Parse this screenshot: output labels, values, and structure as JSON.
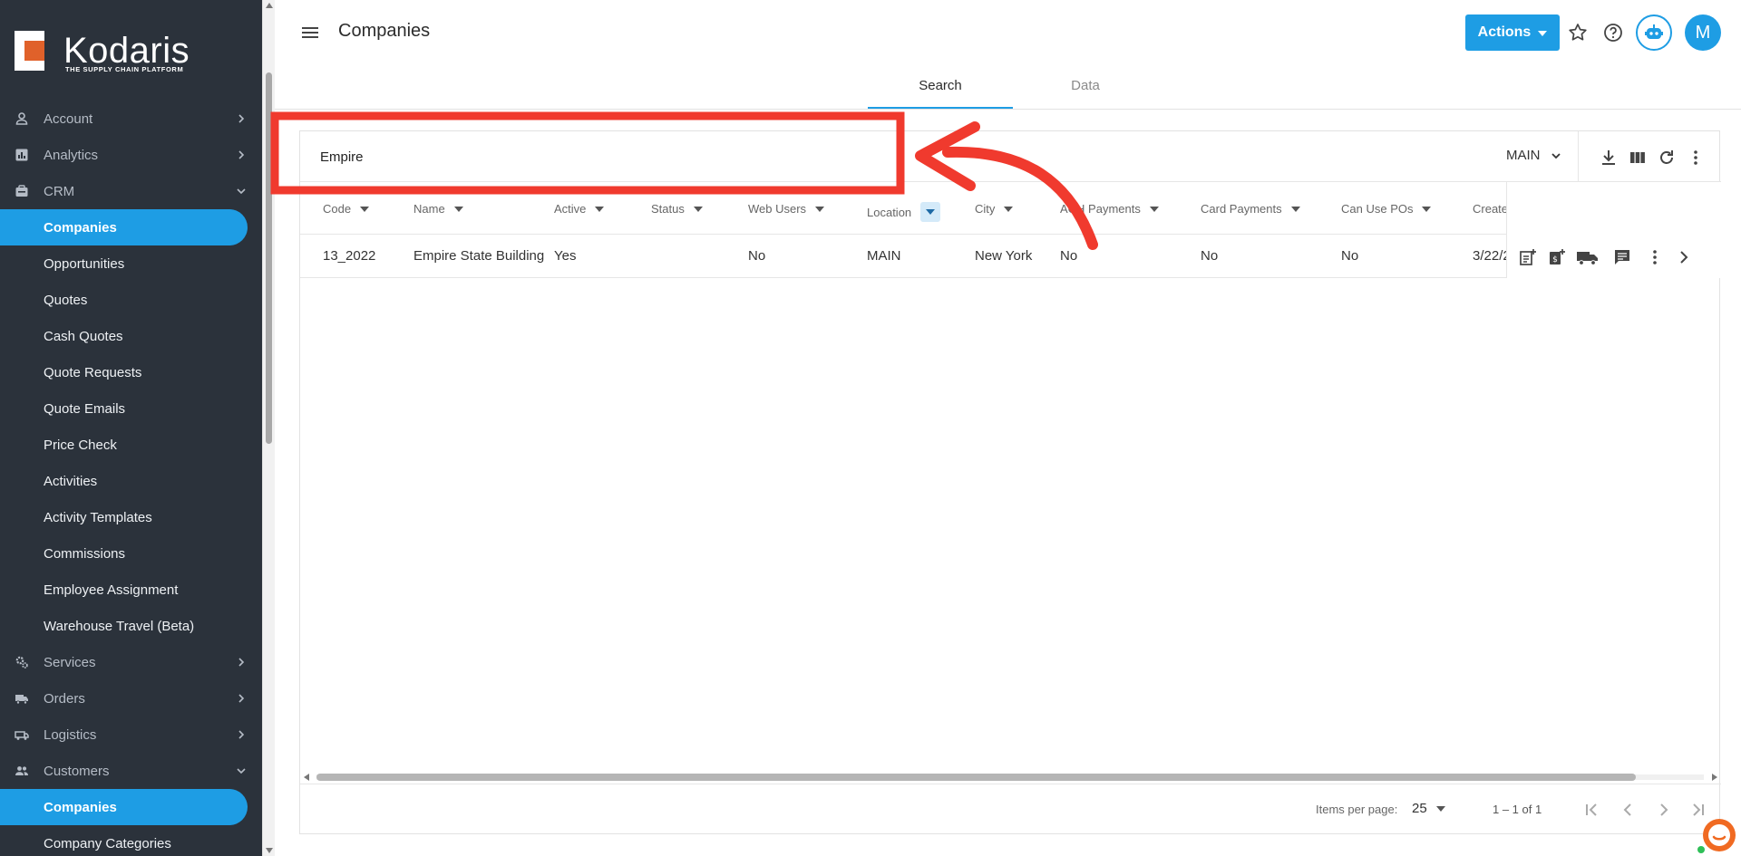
{
  "app": {
    "brand": "Kodaris",
    "tagline": "THE SUPPLY CHAIN PLATFORM",
    "brand_color": "#1e9de4",
    "sidebar_color": "#2b323b"
  },
  "sidebar": {
    "groups": [
      {
        "label": "Account",
        "icon": "person-icon",
        "expanded": false
      },
      {
        "label": "Analytics",
        "icon": "chart-icon",
        "expanded": false
      },
      {
        "label": "CRM",
        "icon": "crm-icon",
        "expanded": true
      },
      {
        "label": "Services",
        "icon": "gears-icon",
        "expanded": false
      },
      {
        "label": "Orders",
        "icon": "truck-icon",
        "expanded": false
      },
      {
        "label": "Logistics",
        "icon": "shipping-icon",
        "expanded": false
      },
      {
        "label": "Customers",
        "icon": "people-icon",
        "expanded": true
      }
    ],
    "crm_items": [
      "Companies",
      "Opportunities",
      "Quotes",
      "Cash Quotes",
      "Quote Requests",
      "Quote Emails",
      "Price Check",
      "Activities",
      "Activity Templates",
      "Commissions",
      "Employee Assignment",
      "Warehouse Travel (Beta)"
    ],
    "customers_items": [
      "Companies",
      "Company Categories"
    ]
  },
  "header": {
    "title": "Companies",
    "actions_label": "Actions",
    "avatar_initial": "M"
  },
  "tabs": [
    {
      "label": "Search",
      "active": true
    },
    {
      "label": "Data",
      "active": false
    }
  ],
  "search": {
    "value": "Empire",
    "location": "MAIN"
  },
  "table": {
    "columns": [
      "Code",
      "Name",
      "Active",
      "Status",
      "Web Users",
      "Location",
      "City",
      "ACH Payments",
      "Card Payments",
      "Can Use POs",
      "Created"
    ],
    "rows": [
      {
        "code": "13_2022",
        "name": "Empire State Building",
        "active": "Yes",
        "status": "",
        "web_users": "No",
        "location": "MAIN",
        "city": "New York",
        "ach": "No",
        "card": "No",
        "pos": "No",
        "created": "3/22/2"
      }
    ]
  },
  "paginator": {
    "items_per_page_label": "Items per page:",
    "items_per_page": "25",
    "range": "1 – 1 of 1"
  },
  "annotation": {
    "highlight_color": "#f03a2e"
  }
}
